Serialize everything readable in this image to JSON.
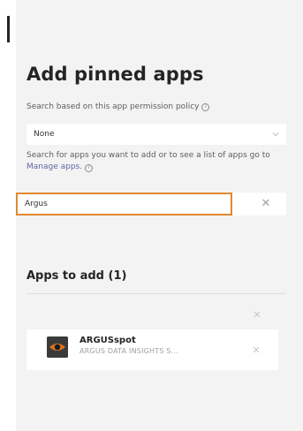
{
  "panel": {
    "title": "Add pinned apps",
    "policy_label": "Search based on this app permission policy",
    "policy_value": "None",
    "search_hint_prefix": "Search for apps you want to add or to see a list of apps go to",
    "search_hint_link": "Manage apps.",
    "search_value": "Argus",
    "clear_symbol": "✕"
  },
  "apps_to_add": {
    "heading": "Apps to add (1)",
    "items": [
      {
        "name": "ARGUSspot",
        "publisher": "ARGUS DATA INSIGHTS S...",
        "icon": "argus-eye-icon",
        "remove_symbol": "✕"
      }
    ],
    "dismiss_symbol": "✕"
  },
  "colors": {
    "accent_focus": "#e1892f",
    "link": "#6264a7"
  }
}
